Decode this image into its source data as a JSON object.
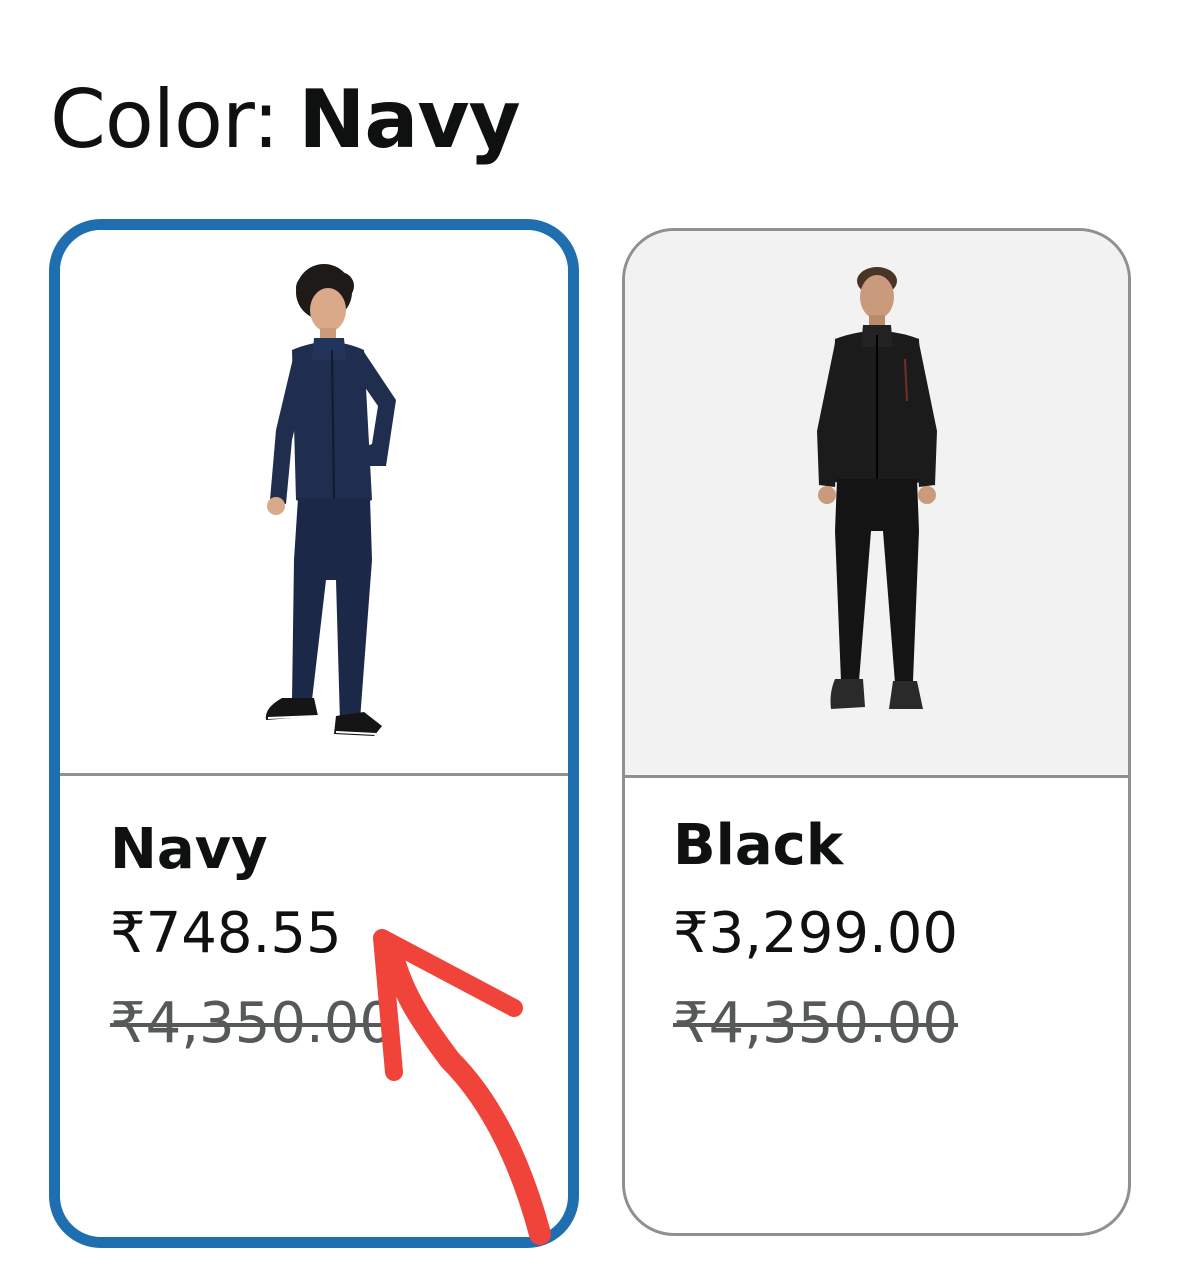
{
  "heading": {
    "label": "Color:",
    "value": "Navy"
  },
  "swatches": [
    {
      "name": "Navy",
      "price": "₹748.55",
      "list_price": "₹4,350.00",
      "selected": true,
      "image_icon": "navy-tracksuit-photo"
    },
    {
      "name": "Black",
      "price": "₹3,299.00",
      "list_price": "₹4,350.00",
      "selected": false,
      "image_icon": "black-tracksuit-photo"
    }
  ],
  "colors": {
    "selected_border": "#1f6fb0",
    "unselected_border": "#8d9191",
    "annotation": "#f0443a",
    "list_price": "#565959"
  }
}
